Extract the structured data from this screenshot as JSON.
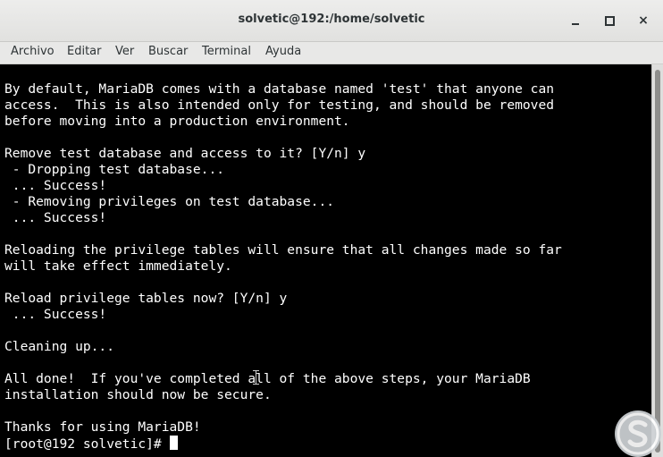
{
  "window": {
    "title": "solvetic@192:/home/solvetic",
    "controls": {
      "minimize_icon": "minimize-icon",
      "maximize_icon": "maximize-icon",
      "close_icon": "close-icon",
      "close_glyph": "×"
    }
  },
  "menubar": {
    "items": [
      "Archivo",
      "Editar",
      "Ver",
      "Buscar",
      "Terminal",
      "Ayuda"
    ]
  },
  "terminal": {
    "lines": [
      "By default, MariaDB comes with a database named 'test' that anyone can",
      "access.  This is also intended only for testing, and should be removed",
      "before moving into a production environment.",
      "",
      "Remove test database and access to it? [Y/n] y",
      " - Dropping test database...",
      " ... Success!",
      " - Removing privileges on test database...",
      " ... Success!",
      "",
      "Reloading the privilege tables will ensure that all changes made so far",
      "will take effect immediately.",
      "",
      "Reload privilege tables now? [Y/n] y",
      " ... Success!",
      "",
      "Cleaning up...",
      "",
      "All done!  If you've completed all of the above steps, your MariaDB",
      "installation should now be secure.",
      "",
      "Thanks for using MariaDB!"
    ],
    "prompt": "[root@192 solvetic]# ",
    "colors": {
      "background": "#000000",
      "foreground": "#ffffff"
    }
  },
  "watermark_icon": "solvetic-logo-icon"
}
